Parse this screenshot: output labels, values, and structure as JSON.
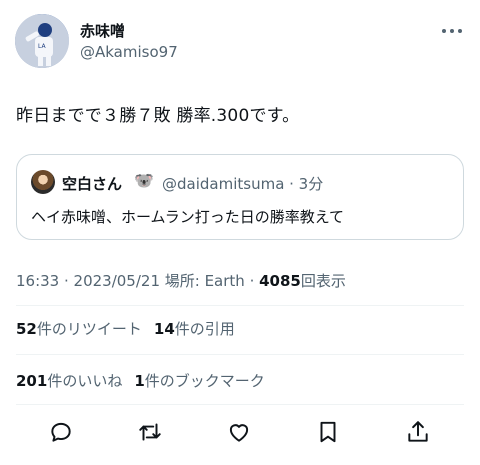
{
  "author": {
    "display_name": "赤味噌",
    "handle": "@Akamiso97"
  },
  "tweet": {
    "text": "昨日までで３勝７敗 勝率.300です。"
  },
  "quote": {
    "display_name": "空白さん",
    "emoji": "🐨",
    "handle_time": "@daidamitsuma · 3分",
    "text": "ヘイ赤味噌、ホームラン打った日の勝率教えて"
  },
  "meta": {
    "time_date_location": "16:33 · 2023/05/21 場所: Earth · ",
    "views_count": "4085",
    "views_label": "回表示"
  },
  "stats": {
    "retweets_count": "52",
    "retweets_label": "件のリツイート",
    "quotes_count": "14",
    "quotes_label": "件の引用",
    "likes_count": "201",
    "likes_label": "件のいいね",
    "bookmarks_count": "1",
    "bookmarks_label": "件のブックマーク"
  },
  "icons": {
    "reply": "reply-icon",
    "retweet": "retweet-icon",
    "like": "heart-icon",
    "bookmark": "bookmark-icon",
    "share": "share-icon",
    "more": "more-icon"
  }
}
